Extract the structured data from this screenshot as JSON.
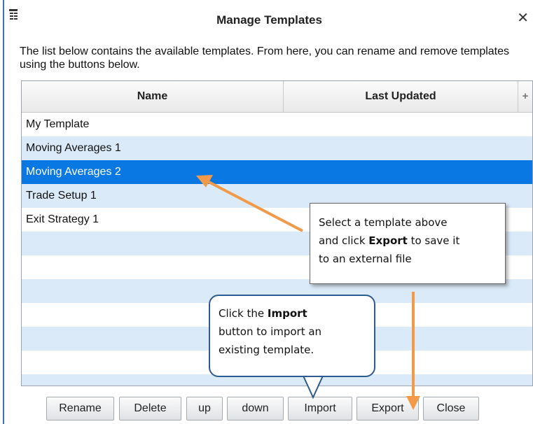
{
  "dialog": {
    "title": "Manage Templates",
    "close_symbol": "✕",
    "description": "The list below contains the available templates.  From here, you can rename and remove templates using the buttons below."
  },
  "grid": {
    "columns": [
      "Name",
      "Last Updated"
    ],
    "add_column_symbol": "+",
    "rows": [
      {
        "name": "My Template",
        "last_updated": ""
      },
      {
        "name": "Moving Averages 1",
        "last_updated": ""
      },
      {
        "name": "Moving Averages 2",
        "last_updated": "",
        "selected": true
      },
      {
        "name": "Trade Setup 1",
        "last_updated": ""
      },
      {
        "name": "Exit Strategy 1",
        "last_updated": ""
      },
      {
        "name": "",
        "last_updated": ""
      },
      {
        "name": "",
        "last_updated": ""
      },
      {
        "name": "",
        "last_updated": ""
      },
      {
        "name": "",
        "last_updated": ""
      },
      {
        "name": "",
        "last_updated": ""
      },
      {
        "name": "",
        "last_updated": ""
      },
      {
        "name": "",
        "last_updated": ""
      }
    ]
  },
  "buttons": {
    "rename": "Rename",
    "delete": "Delete",
    "up": "up",
    "down": "down",
    "import": "Import",
    "export": "Export",
    "close": "Close"
  },
  "callouts": {
    "export": {
      "line1": "Select a template above",
      "line2_pre": "and click ",
      "line2_bold": "Export",
      "line2_post": " to save it",
      "line3": "to an external file"
    },
    "import": {
      "line1_pre": "Click the ",
      "line1_bold": "Import",
      "line2": "button to import an",
      "line3": "existing template."
    }
  },
  "icons": {
    "title_icon": "window-menu-icon",
    "close": "close-icon",
    "arrows": "annotation-arrow-icon"
  },
  "colors": {
    "selected_row": "#0a78e2",
    "alt_row": "#dbeaf8",
    "arrow": "#f29a4a",
    "callout_border": "#2d5a8f",
    "window_border": "#3c72b8"
  }
}
